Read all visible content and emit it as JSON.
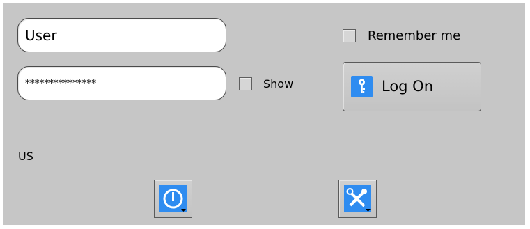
{
  "login": {
    "username_value": "User",
    "password_masked": "***************",
    "show_label": "Show",
    "remember_label": "Remember me",
    "logon_label": "Log On",
    "keyboard_layout": "US"
  },
  "icons": {
    "logon": "key-icon",
    "power": "power-icon",
    "tools": "tools-icon",
    "menu_indicator": "dropdown-arrow-icon"
  },
  "colors": {
    "background": "#c6c6c6",
    "field": "#ffffff",
    "accent": "#2f8cf0"
  }
}
